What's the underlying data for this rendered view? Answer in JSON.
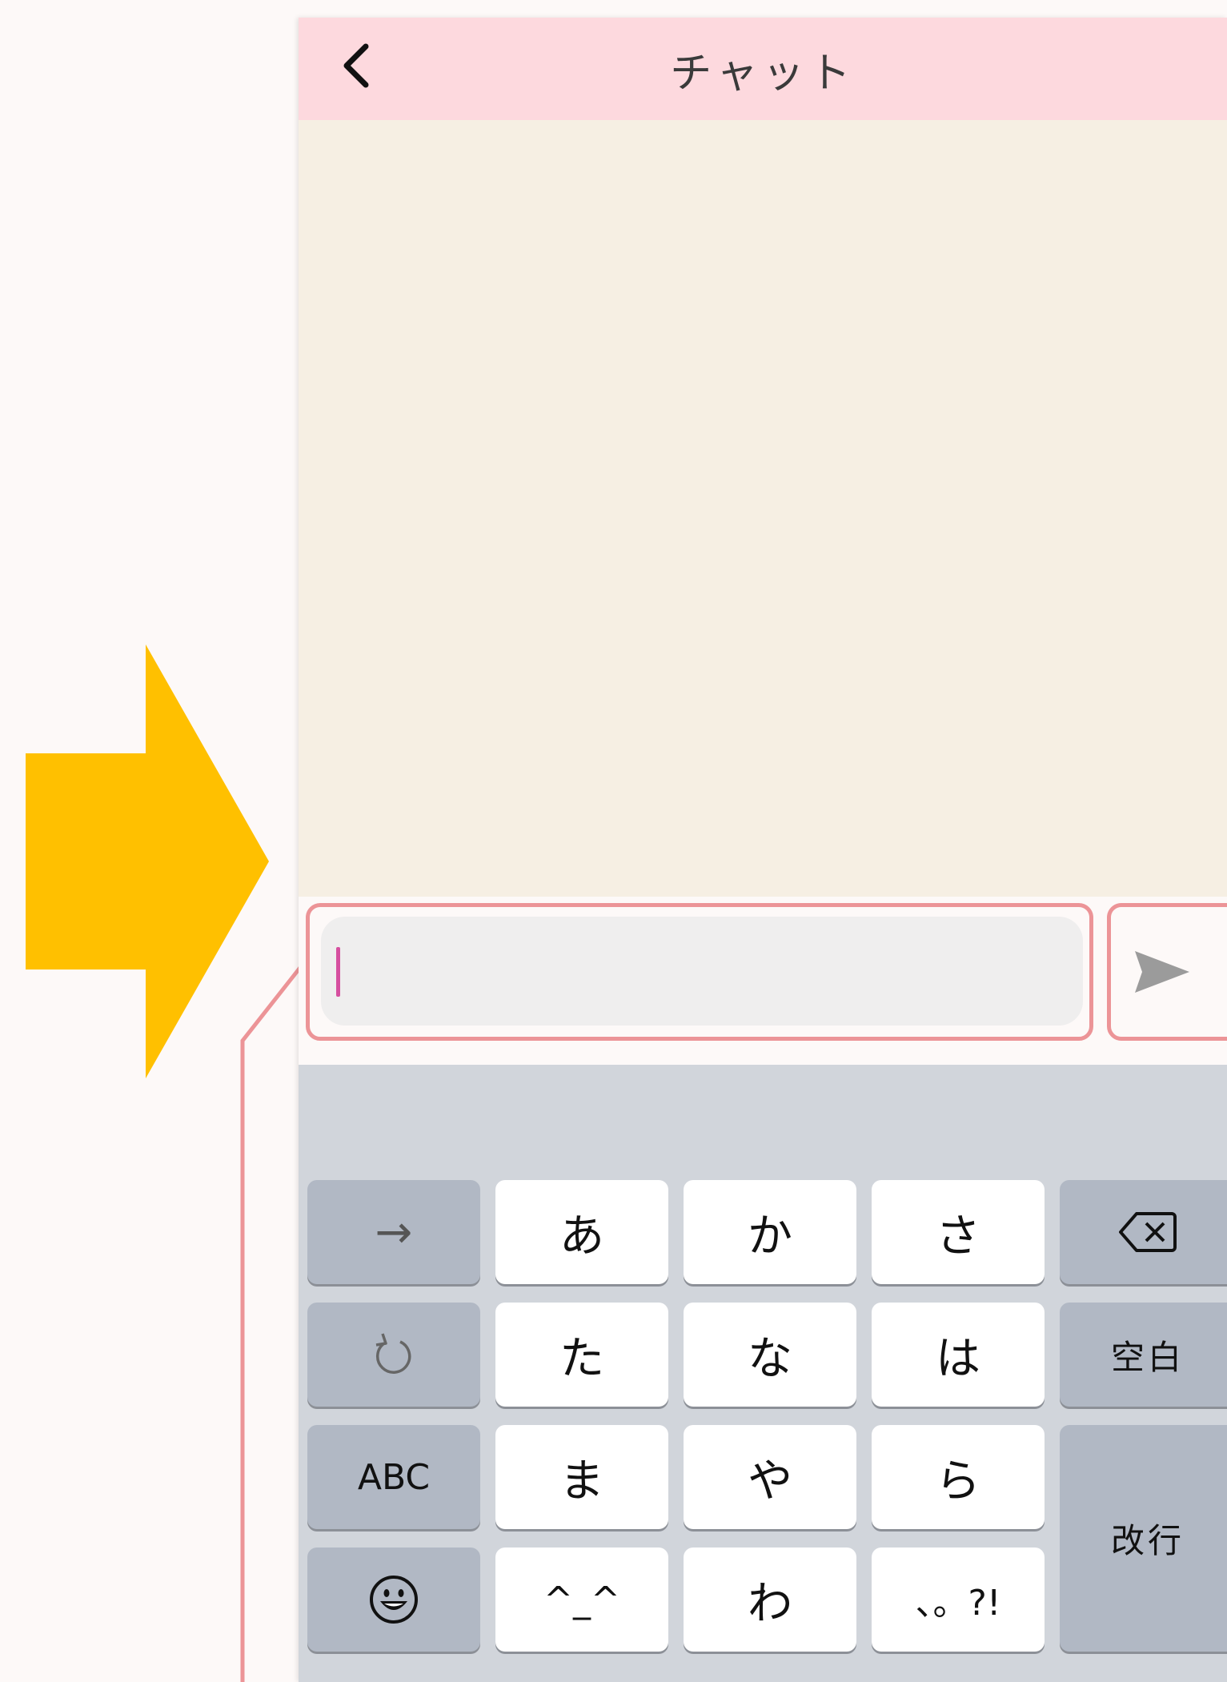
{
  "header": {
    "title": "チャット",
    "back_icon": "chevron-left-icon"
  },
  "input": {
    "value": "",
    "placeholder": ""
  },
  "send": {
    "icon": "paper-plane-send-icon"
  },
  "keyboard": {
    "rows": [
      [
        "→",
        "あ",
        "か",
        "さ",
        "⌫"
      ],
      [
        "↺",
        "た",
        "な",
        "は",
        "空白"
      ],
      [
        "ABC",
        "ま",
        "や",
        "ら",
        "改行"
      ],
      [
        "☺",
        "^_^",
        "わ_",
        "、。?!"
      ]
    ],
    "arrow_label": "→",
    "a": "あ",
    "ka": "か",
    "sa": "さ",
    "ta": "た",
    "na": "な",
    "ha": "は",
    "space": "空白",
    "abc": "ABC",
    "ma": "ま",
    "ya": "や",
    "ra": "ら",
    "return": "改行",
    "kaomoji": "^_^",
    "wa": "わ",
    "punct": "、。?!"
  },
  "colors": {
    "header_bg": "#fdd9de",
    "chat_bg": "#f6efe3",
    "highlight_border": "#ec9497",
    "arrow": "#ffc000",
    "caret": "#d64f9f",
    "keyboard_bg": "#d1d5db"
  }
}
